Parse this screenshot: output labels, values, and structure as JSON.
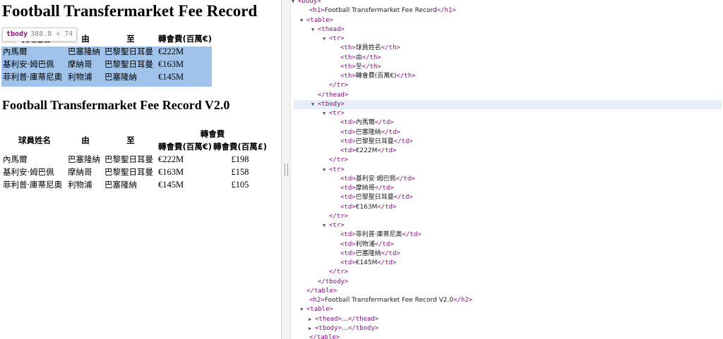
{
  "page": {
    "h1": "Football Transfermarket Fee Record",
    "h2": "Football Transfermarket Fee Record V2.0",
    "table1": {
      "headers": [
        "球員姓名",
        "由",
        "至",
        "轉會費(百萬€)"
      ],
      "rows": [
        [
          "內馬爾",
          "巴塞隆納",
          "巴黎聖日耳曼",
          "€222M"
        ],
        [
          "基利安·姆巴佩",
          "摩納哥",
          "巴黎聖日耳曼",
          "€163M"
        ],
        [
          "菲利普·庫蒂尼奧",
          "利物浦",
          "巴塞隆納",
          "€145M"
        ]
      ]
    },
    "table2": {
      "headers_top": [
        "球員姓名",
        "由",
        "至",
        "轉會費"
      ],
      "headers_sub": [
        "轉會費(百萬€)",
        "轉會費(百萬£)"
      ],
      "rows": [
        [
          "內馬爾",
          "巴塞隆納",
          "巴黎聖日耳曼",
          "€222M",
          "£198"
        ],
        [
          "基利安·姆巴佩",
          "摩納哥",
          "巴黎聖日耳曼",
          "€163M",
          "£158"
        ],
        [
          "菲利普·庫蒂尼奧",
          "利物浦",
          "巴塞隆納",
          "€145M",
          "£105"
        ]
      ]
    }
  },
  "tooltip": {
    "tag": "tbody",
    "dims": "388.8 × 74"
  },
  "devtools": {
    "lines": [
      "<body>",
      "<h1>Football Transfermarket Fee Record</h1>",
      "<table>",
      "<thead>",
      "<tr>",
      "<th>球員姓名</th>",
      "<th>由</th>",
      "<th>至</th>",
      "<th>轉會費(百萬€)</th>",
      "</tr>",
      "</thead>",
      "<tbody>",
      "<tr>",
      "<td>內馬爾</td>",
      "<td>巴塞隆納</td>",
      "<td>巴黎聖日耳曼</td>",
      "<td>€222M</td>",
      "</tr>",
      "<tr>",
      "<td>基利安·姆巴佩</td>",
      "<td>摩納哥</td>",
      "<td>巴黎聖日耳曼</td>",
      "<td>€163M</td>",
      "</tr>",
      "<tr>",
      "<td>菲利普·庫蒂尼奧</td>",
      "<td>利物浦</td>",
      "<td>巴塞隆納</td>",
      "<td>€145M</td>",
      "</tr>",
      "</tbody>",
      "</table>",
      "<h2>Football Transfermarket Fee Record V2.0</h2>",
      "<table>",
      "<thead>…</thead>",
      "<tbody>…</tbody>",
      "</table>"
    ],
    "triangles": [
      "▼",
      "",
      "▼",
      "▼",
      "▼",
      "",
      "",
      "",
      "",
      "",
      "",
      "▼",
      "▼",
      "",
      "",
      "",
      "",
      "",
      "▼",
      "",
      "",
      "",
      "",
      "",
      "▼",
      "",
      "",
      "",
      "",
      "",
      "",
      "",
      "",
      "▼",
      "▶",
      "▶",
      ""
    ]
  }
}
